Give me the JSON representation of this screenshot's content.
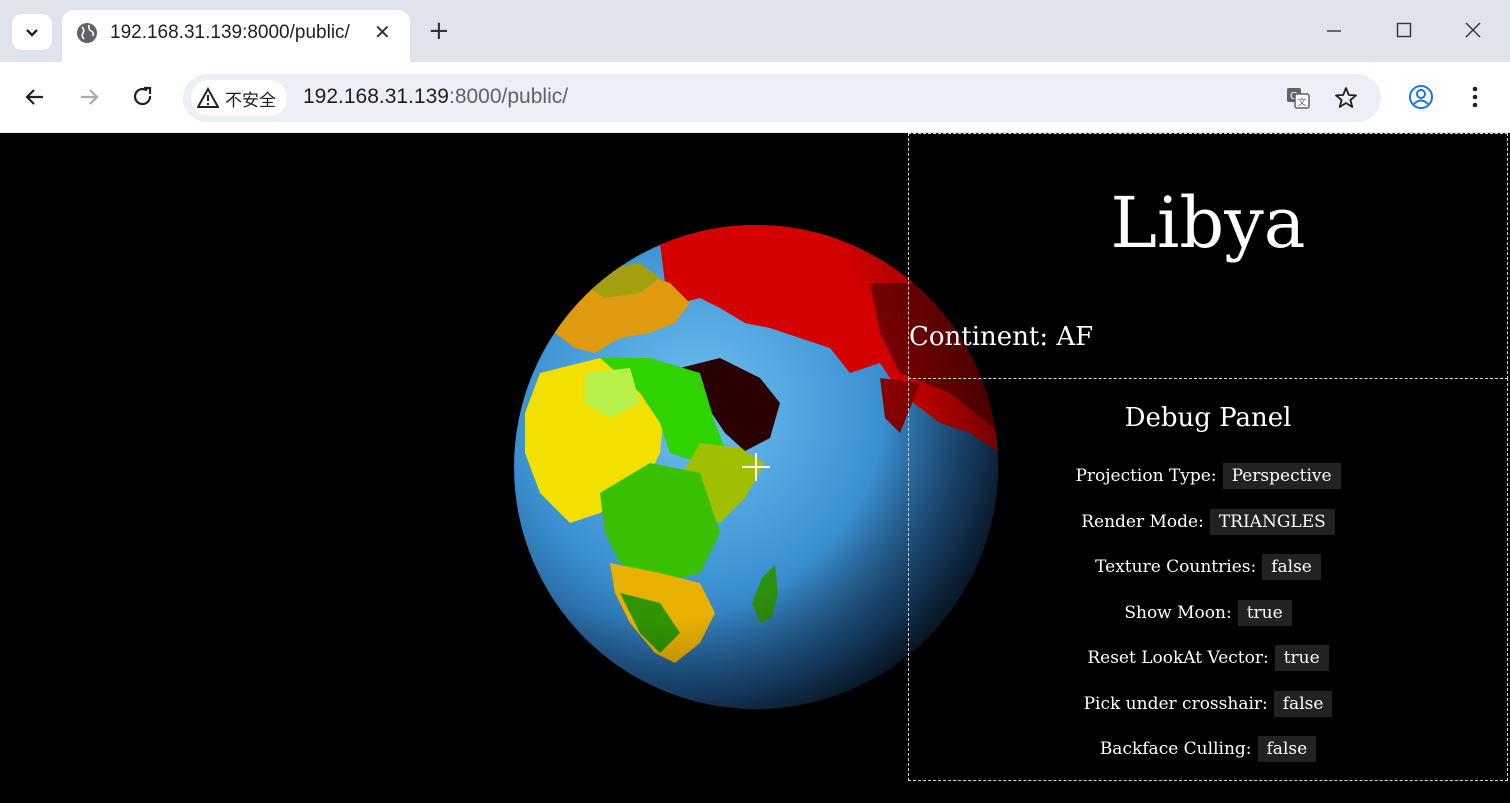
{
  "browser": {
    "tab_title": "192.168.31.139:8000/public/",
    "security_label": "不安全",
    "url_host": "192.168.31.139",
    "url_rest": ":8000/public/"
  },
  "info": {
    "country": "Libya",
    "continent_label": "Continent:",
    "continent_value": "AF"
  },
  "debug": {
    "title": "Debug Panel",
    "rows": [
      {
        "label": "Projection Type:",
        "value": "Perspective"
      },
      {
        "label": "Render Mode:",
        "value": "TRIANGLES"
      },
      {
        "label": "Texture Countries:",
        "value": "false"
      },
      {
        "label": "Show Moon:",
        "value": "true"
      },
      {
        "label": "Reset LookAt Vector:",
        "value": "true"
      },
      {
        "label": "Pick under crosshair:",
        "value": "false"
      },
      {
        "label": "Backface Culling:",
        "value": "false"
      }
    ]
  },
  "colors": {
    "ocean": "#3a8fd0",
    "europe_asia": "#d40000",
    "africa_yellow": "#f2e000",
    "africa_green": "#33cc00"
  },
  "icons": [
    "chevron-down-icon",
    "globe-icon",
    "close-icon",
    "plus-icon",
    "minimize-icon",
    "maximize-icon",
    "window-close-icon",
    "back-arrow-icon",
    "forward-arrow-icon",
    "reload-icon",
    "warning-icon",
    "translate-icon",
    "star-icon",
    "profile-icon",
    "kebab-menu-icon",
    "crosshair-icon"
  ]
}
